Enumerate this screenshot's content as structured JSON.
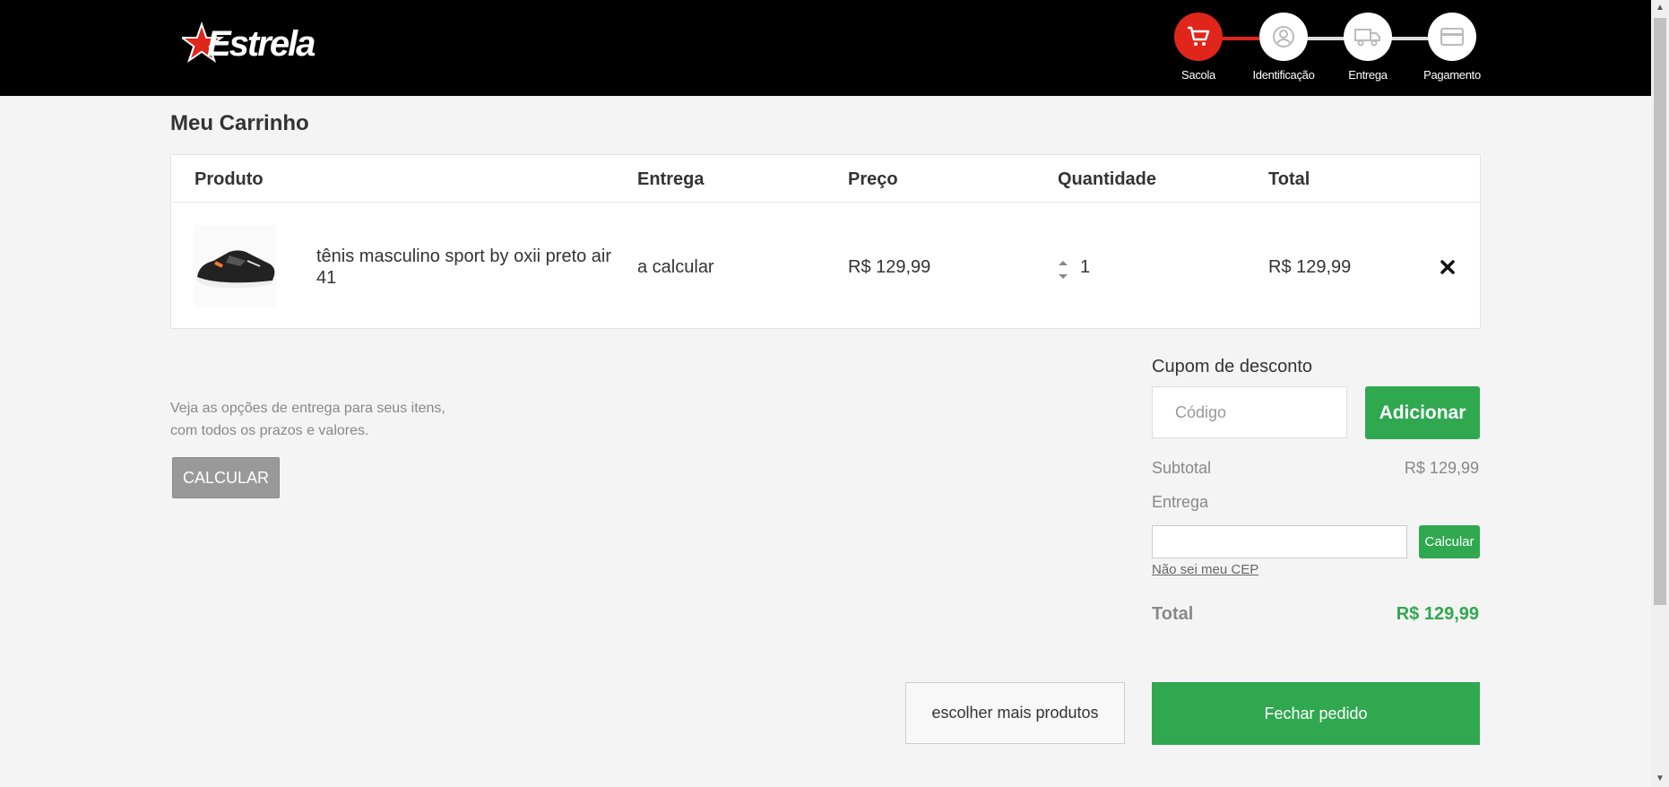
{
  "header": {
    "logo_text": "Estrela",
    "steps": [
      {
        "label": "Sacola",
        "icon": "cart-icon",
        "active": true
      },
      {
        "label": "Identificação",
        "icon": "user-icon",
        "active": false
      },
      {
        "label": "Entrega",
        "icon": "truck-icon",
        "active": false
      },
      {
        "label": "Pagamento",
        "icon": "card-icon",
        "active": false
      }
    ]
  },
  "cart": {
    "title": "Meu Carrinho",
    "columns": [
      "Produto",
      "Entrega",
      "Preço",
      "Quantidade",
      "Total"
    ],
    "items": [
      {
        "name": "tênis masculino sport by oxii preto air 41",
        "delivery": "a calcular",
        "price": "R$ 129,99",
        "quantity": "1",
        "total": "R$ 129,99",
        "remove_icon": "close-icon"
      }
    ]
  },
  "shipping": {
    "info": "Veja as opções de entrega para seus itens, com todos os prazos e valores.",
    "calc_label": "CALCULAR"
  },
  "summary": {
    "coupon_label": "Cupom de desconto",
    "coupon_placeholder": "Código",
    "coupon_button": "Adicionar",
    "subtotal_label": "Subtotal",
    "subtotal_value": "R$ 129,99",
    "delivery_label": "Entrega",
    "cep_value": "",
    "cep_button": "Calcular",
    "cep_link": "Não sei meu CEP",
    "total_label": "Total",
    "total_value": "R$ 129,99"
  },
  "actions": {
    "more_products": "escolher mais produtos",
    "checkout": "Fechar pedido"
  },
  "colors": {
    "brand_red": "#e0261b",
    "green": "#2fa84f",
    "header_bg": "#000000"
  }
}
